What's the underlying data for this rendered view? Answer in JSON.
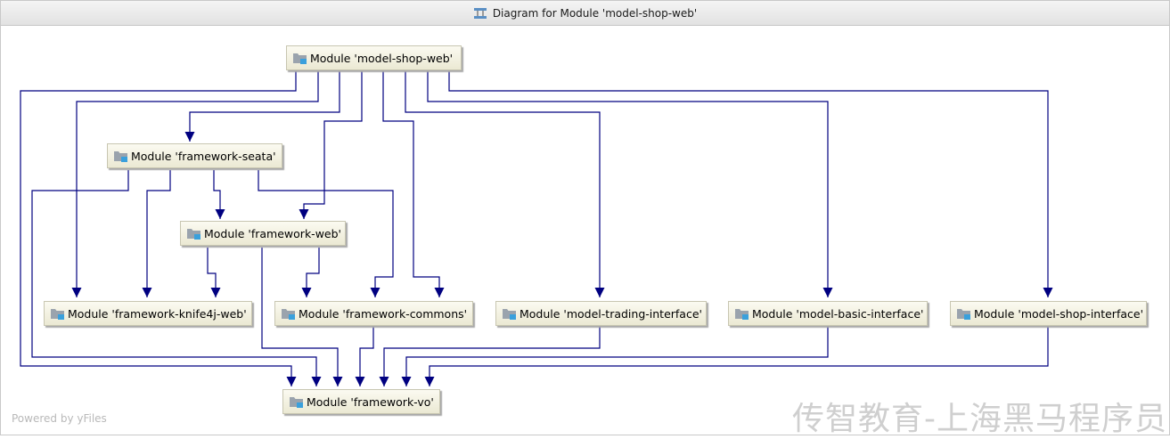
{
  "window": {
    "title": "Diagram for Module 'model-shop-web'",
    "icon": "diagram-icon"
  },
  "nodes": {
    "model_shop_web": "Module 'model-shop-web'",
    "framework_seata": "Module 'framework-seata'",
    "framework_web": "Module 'framework-web'",
    "framework_knife4j_web": "Module 'framework-knife4j-web'",
    "framework_commons": "Module 'framework-commons'",
    "model_trading_interface": "Module 'model-trading-interface'",
    "model_basic_interface": "Module 'model-basic-interface'",
    "model_shop_interface": "Module 'model-shop-interface'",
    "framework_vo": "Module 'framework-vo'"
  },
  "node_icon": "module-folder-icon",
  "edges": [
    [
      "model_shop_web",
      "framework_vo"
    ],
    [
      "model_shop_web",
      "framework_knife4j_web"
    ],
    [
      "model_shop_web",
      "framework_seata"
    ],
    [
      "model_shop_web",
      "framework_web"
    ],
    [
      "model_shop_web",
      "framework_commons"
    ],
    [
      "model_shop_web",
      "model_trading_interface"
    ],
    [
      "model_shop_web",
      "model_basic_interface"
    ],
    [
      "model_shop_web",
      "model_shop_interface"
    ],
    [
      "framework_seata",
      "framework_vo"
    ],
    [
      "framework_seata",
      "framework_knife4j_web"
    ],
    [
      "framework_seata",
      "framework_web"
    ],
    [
      "framework_seata",
      "framework_commons"
    ],
    [
      "framework_web",
      "framework_knife4j_web"
    ],
    [
      "framework_web",
      "framework_commons"
    ],
    [
      "framework_web",
      "framework_vo"
    ],
    [
      "framework_commons",
      "framework_vo"
    ],
    [
      "model_trading_interface",
      "framework_vo"
    ],
    [
      "model_basic_interface",
      "framework_vo"
    ],
    [
      "model_shop_interface",
      "framework_vo"
    ]
  ],
  "colors": {
    "edge": "#000080",
    "node_top": "#fbfaf1",
    "node_bottom": "#ebe9d3",
    "node_border": "#c8c6b1"
  },
  "footer": {
    "powered_by": "Powered by yFiles",
    "watermark": "传智教育-上海黑马程序员"
  }
}
